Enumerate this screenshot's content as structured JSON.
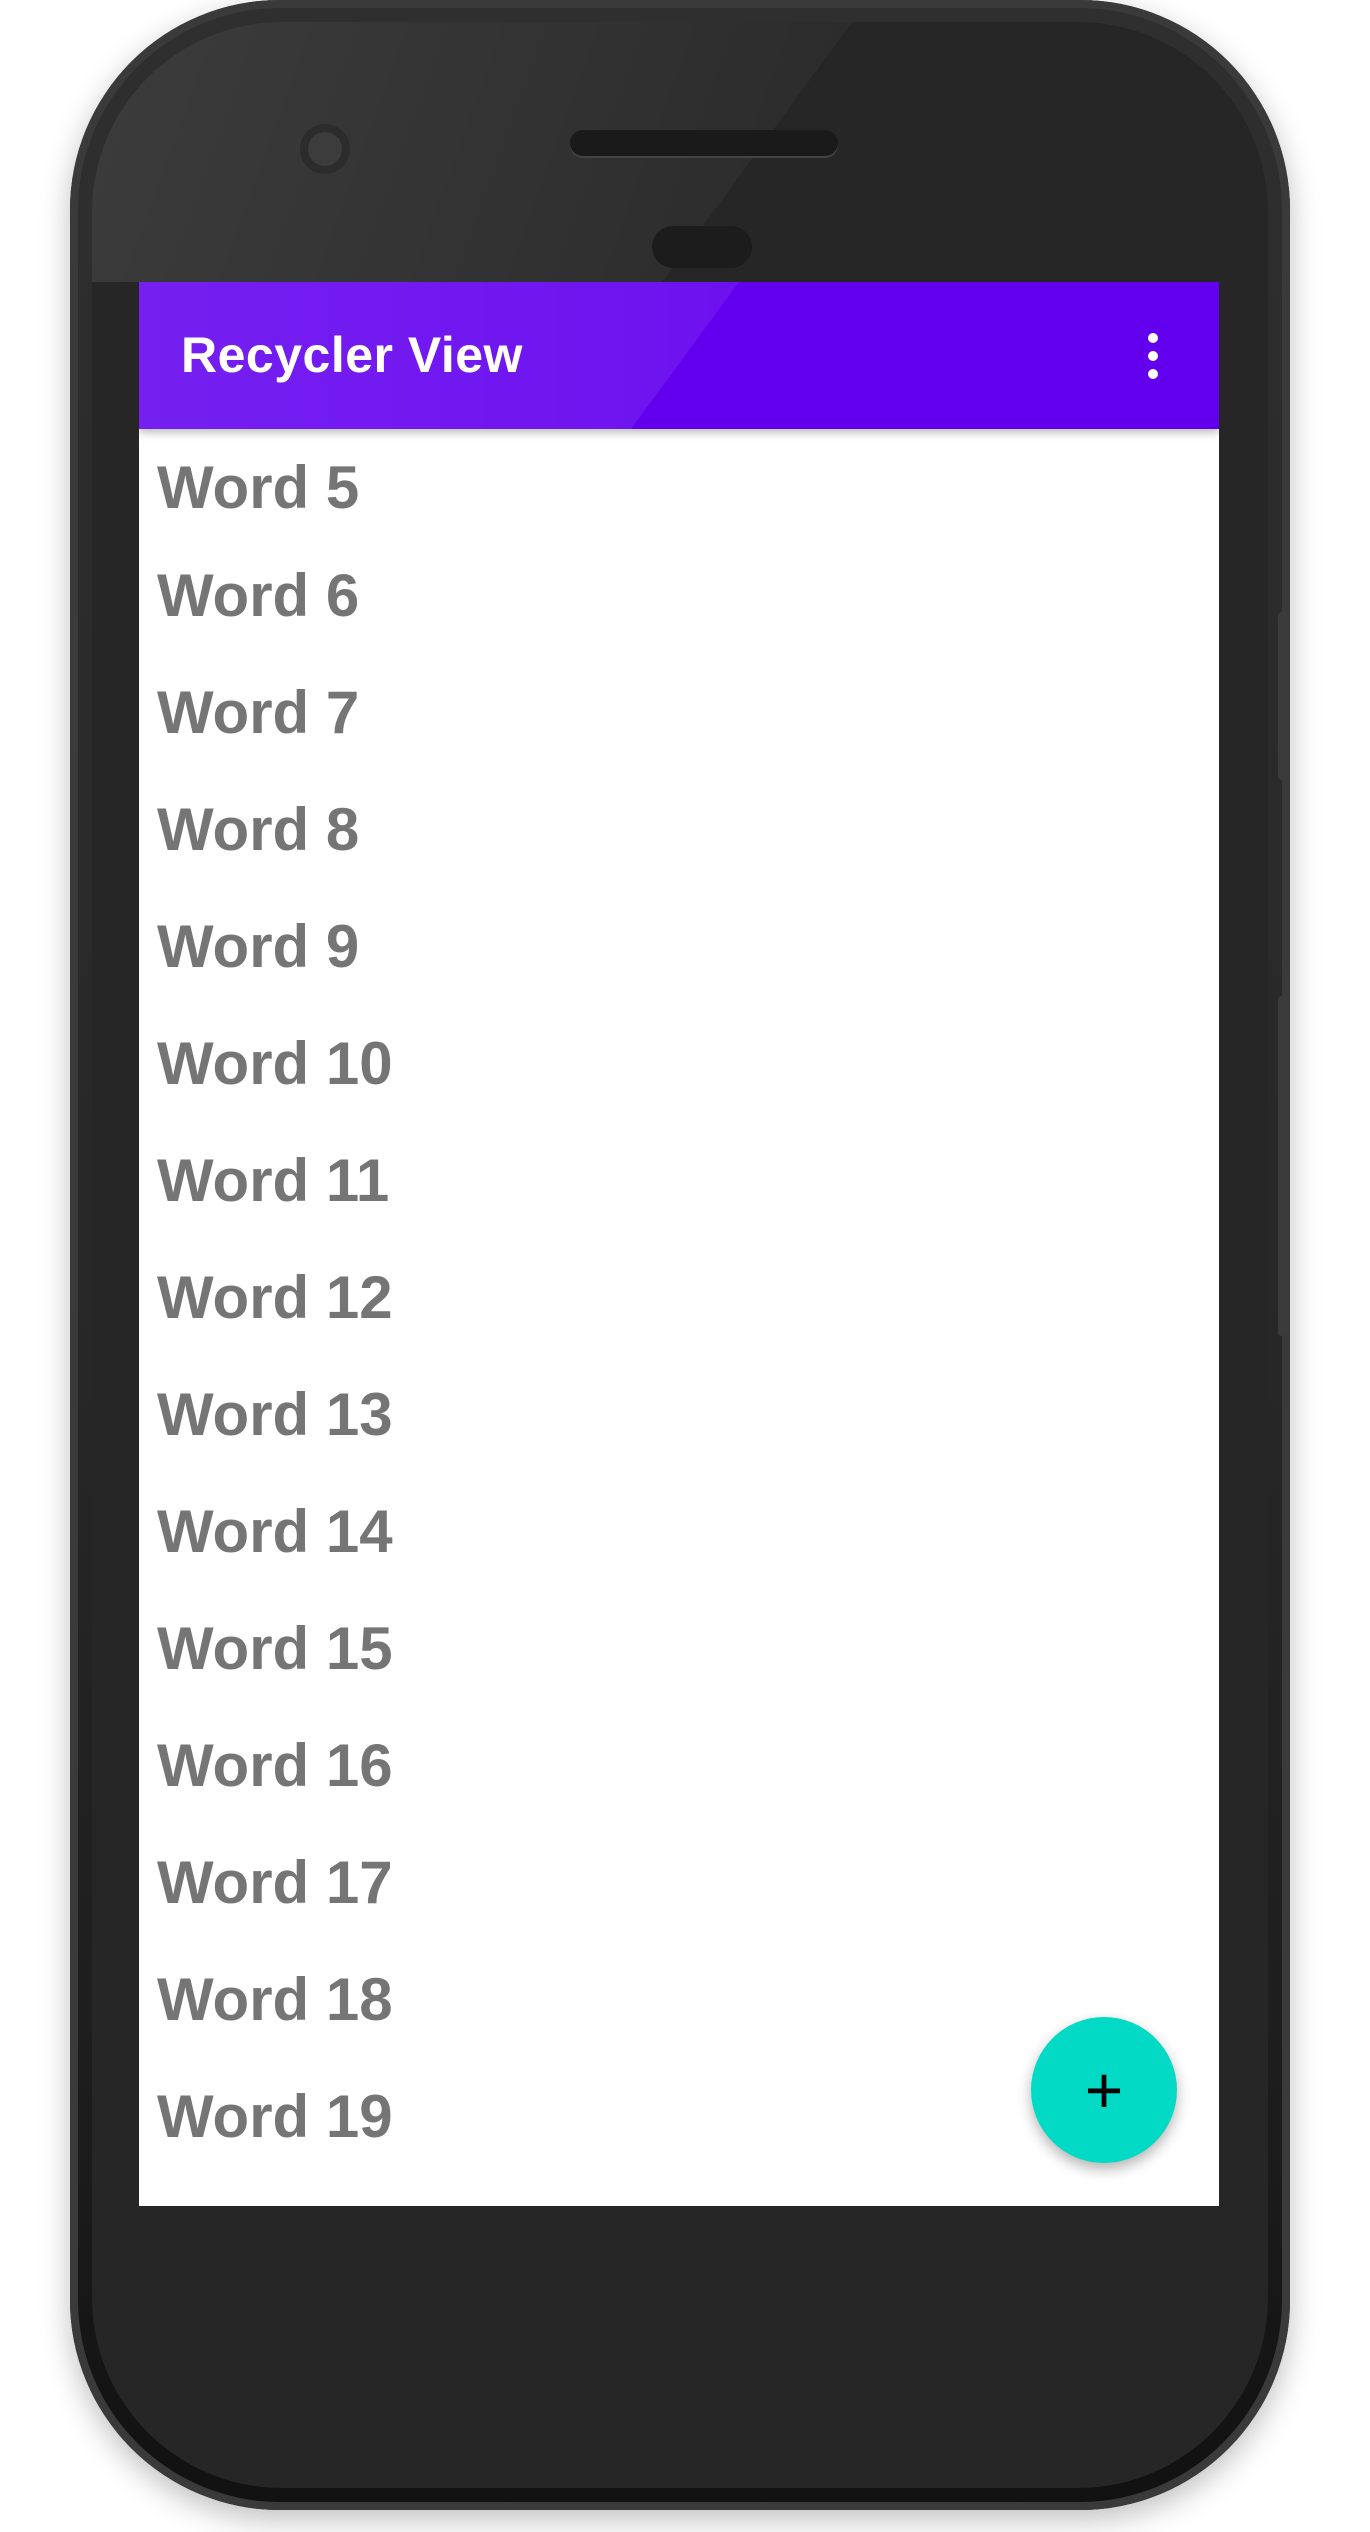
{
  "app_bar": {
    "title": "Recycler View",
    "background_color": "#6200ee",
    "overflow_icon": "more-vert-icon"
  },
  "word_list": {
    "text_color": "#757575",
    "items": [
      "Word 5",
      "Word 6",
      "Word 7",
      "Word 8",
      "Word 9",
      "Word 10",
      "Word 11",
      "Word 12",
      "Word 13",
      "Word 14",
      "Word 15",
      "Word 16",
      "Word 17",
      "Word 18",
      "Word 19"
    ]
  },
  "fab": {
    "icon": "plus-icon",
    "symbol": "+",
    "color": "#03dac5"
  }
}
